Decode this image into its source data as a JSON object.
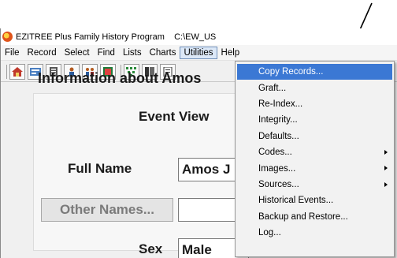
{
  "window": {
    "title": "EZITREE Plus Family History Program    C:\\EW_US"
  },
  "menubar": {
    "items": [
      "File",
      "Record",
      "Select",
      "Find",
      "Lists",
      "Charts",
      "Utilities",
      "Help"
    ],
    "active": "Utilities"
  },
  "toolbar": {
    "icons": [
      "home-icon",
      "card-icon",
      "list-icon",
      "person-icon",
      "people-icon",
      "book-icon",
      "tree-icon",
      "binder-icon",
      "document-icon"
    ]
  },
  "main": {
    "heading": "Information about Amos",
    "event_title": "Event View",
    "fullname_label": "Full Name",
    "fullname_value": "Amos J",
    "other_names_button": "Other Names...",
    "sex_label": "Sex",
    "sex_value": "Male"
  },
  "dropdown": {
    "items": [
      {
        "label": "Copy Records...",
        "highlighted": true,
        "submenu": false
      },
      {
        "label": "Graft...",
        "highlighted": false,
        "submenu": false
      },
      {
        "label": "Re-Index...",
        "highlighted": false,
        "submenu": false
      },
      {
        "label": "Integrity...",
        "highlighted": false,
        "submenu": false
      },
      {
        "label": "Defaults...",
        "highlighted": false,
        "submenu": false
      },
      {
        "label": "Codes...",
        "highlighted": false,
        "submenu": true
      },
      {
        "label": "Images...",
        "highlighted": false,
        "submenu": true
      },
      {
        "label": "Sources...",
        "highlighted": false,
        "submenu": true
      },
      {
        "label": "Historical Events...",
        "highlighted": false,
        "submenu": false
      },
      {
        "label": "Backup and Restore...",
        "highlighted": false,
        "submenu": false
      },
      {
        "label": "Log...",
        "highlighted": false,
        "submenu": false
      }
    ]
  },
  "colors": {
    "highlight": "#3b78d4",
    "menu_active_bg": "#dce8f7"
  }
}
